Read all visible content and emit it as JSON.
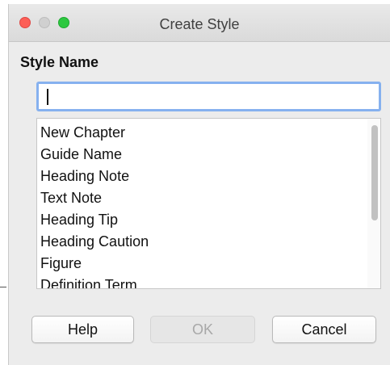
{
  "window": {
    "title": "Create Style"
  },
  "form": {
    "style_name_label": "Style Name",
    "style_name_value": "",
    "styles": [
      "New Chapter",
      "Guide Name",
      "Heading Note",
      "Text Note",
      "Heading Tip",
      "Heading Caution",
      "Figure",
      "Definition Term"
    ]
  },
  "buttons": {
    "help": "Help",
    "ok": "OK",
    "cancel": "Cancel"
  },
  "colors": {
    "close": "#fc5f57",
    "minimize": "#d0d0d0",
    "maximize": "#2dc840",
    "focus_ring": "#86b1ef"
  }
}
